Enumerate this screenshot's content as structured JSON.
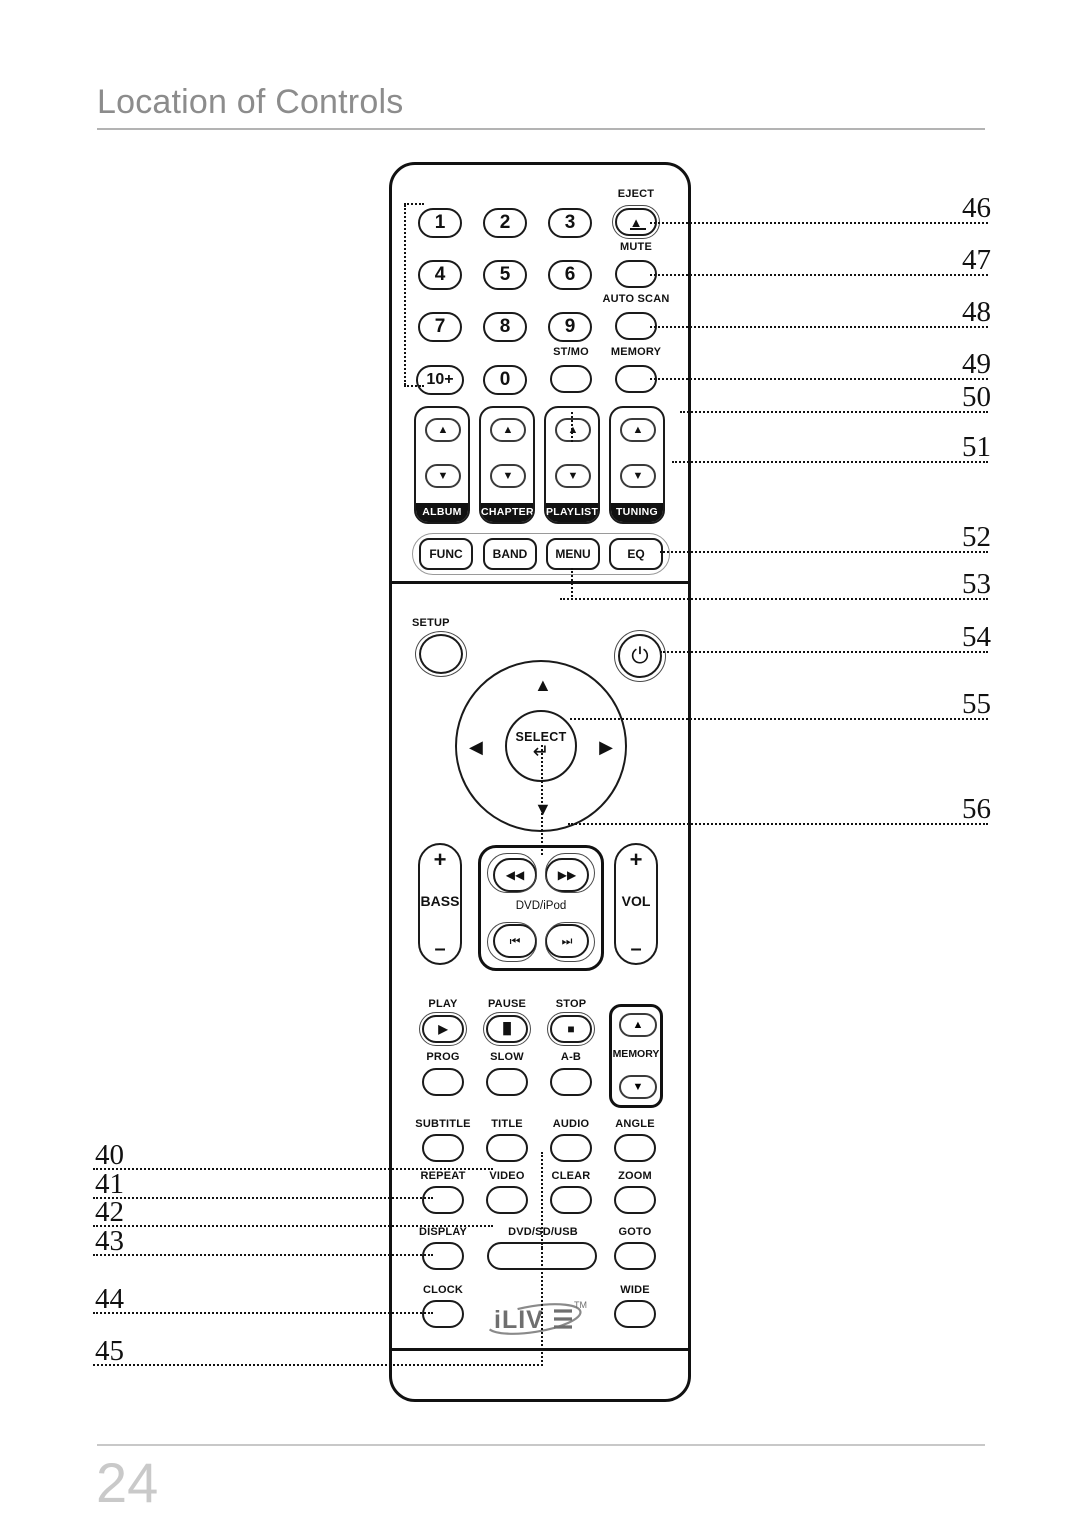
{
  "header": {
    "title": "Location of Controls"
  },
  "footer": {
    "page_number": "24"
  },
  "remote": {
    "brand_logo": "iLIVE",
    "trademark": "TM",
    "numeric_keys": [
      "1",
      "2",
      "3",
      "4",
      "5",
      "6",
      "7",
      "8",
      "9",
      "10+",
      "0"
    ],
    "top_labels": {
      "eject": "EJECT",
      "mute": "MUTE",
      "auto_scan": "AUTO SCAN",
      "st_mo": "ST/MO",
      "memory": "MEMORY"
    },
    "rockers": [
      {
        "label": "ALBUM",
        "up": "▲",
        "down": "▼"
      },
      {
        "label": "CHAPTER",
        "up": "▲",
        "down": "▼"
      },
      {
        "label": "PLAYLIST",
        "up": "▲",
        "down": "▼"
      },
      {
        "label": "TUNING",
        "up": "▲",
        "down": "▼"
      }
    ],
    "func_row": [
      "FUNC",
      "BAND",
      "MENU",
      "EQ"
    ],
    "setup_label": "SETUP",
    "power_icon": "⏻",
    "select": {
      "label": "SELECT",
      "arrow": "↵"
    },
    "dpad": {
      "up": "▲",
      "down": "▼",
      "left": "◀",
      "right": "▶"
    },
    "bass": {
      "name": "BASS",
      "plus": "+",
      "minus": "–"
    },
    "vol": {
      "name": "VOL",
      "plus": "+",
      "minus": "–"
    },
    "transport": {
      "label": "DVD/iPod",
      "rew": "◀◀",
      "ff": "▶▶",
      "prev": "⏮",
      "next": "⏭"
    },
    "playback_row": [
      {
        "label": "PLAY",
        "glyph": "▶"
      },
      {
        "label": "PAUSE",
        "glyph": "▐▌"
      },
      {
        "label": "STOP",
        "glyph": "■"
      }
    ],
    "prog_row": [
      "PROG",
      "SLOW",
      "A-B"
    ],
    "memory_rocker": {
      "label": "MEMORY",
      "up": "▲",
      "down": "▼"
    },
    "function_rows": [
      [
        "SUBTITLE",
        "TITLE",
        "AUDIO",
        "ANGLE"
      ],
      [
        "REPEAT",
        "VIDEO",
        "CLEAR",
        "ZOOM"
      ],
      [
        "DISPLAY",
        "DVD/SD/USB",
        "GOTO"
      ]
    ],
    "bottom_row": [
      "CLOCK",
      "WIDE"
    ]
  },
  "callouts": {
    "right": [
      "46",
      "47",
      "48",
      "49",
      "50",
      "51",
      "52",
      "53",
      "54",
      "55",
      "56"
    ],
    "left": [
      "40",
      "41",
      "42",
      "43",
      "44",
      "45"
    ]
  },
  "colors": {
    "title_gray": "#8c8c8c",
    "rule_gray": "#b3b3b3",
    "page_number_gray": "#c9c9c9",
    "ink": "#111111",
    "logo_gray": "#8a8a8a"
  }
}
